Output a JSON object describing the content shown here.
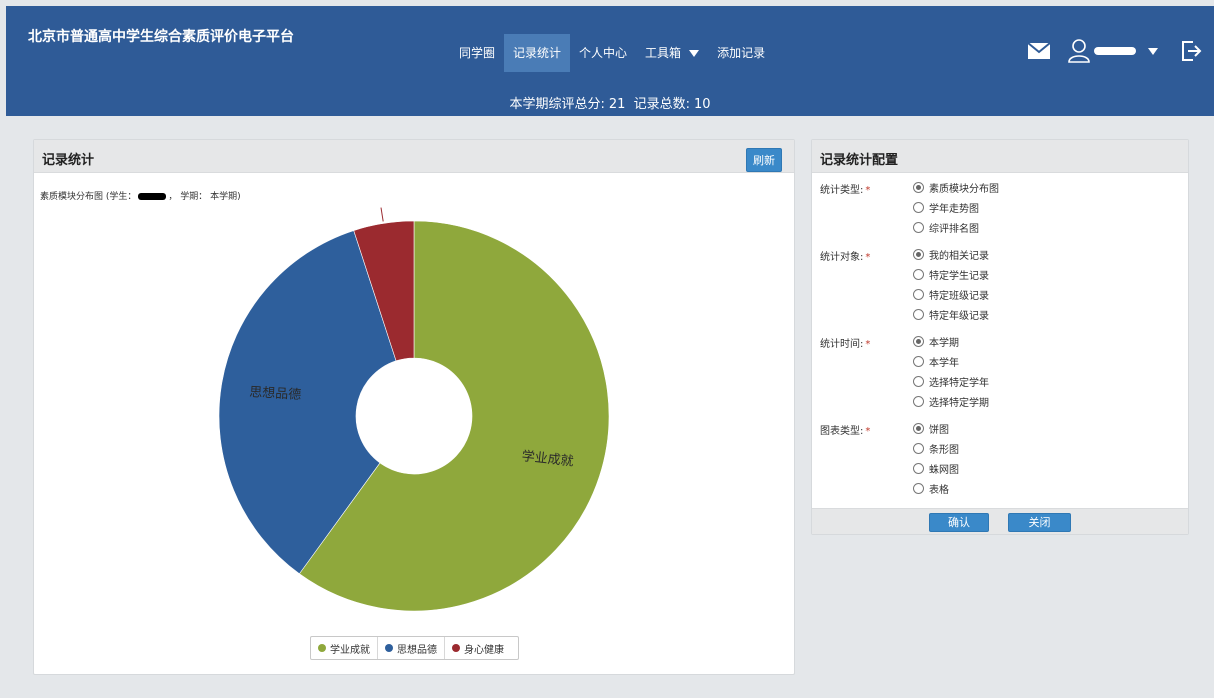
{
  "app_title": "北京市普通高中学生综合素质评价电子平台",
  "nav": [
    {
      "label": "同学圈",
      "active": false
    },
    {
      "label": "记录统计",
      "active": true
    },
    {
      "label": "个人中心",
      "active": false
    },
    {
      "label": "工具箱",
      "active": false,
      "dropdown": true
    },
    {
      "label": "添加记录",
      "active": false
    }
  ],
  "summary": {
    "score_label": "本学期综评总分:",
    "score": "21",
    "count_label": "记录总数:",
    "count": "10"
  },
  "header_icons": [
    "mail-icon",
    "user-icon",
    "chevron-down-icon",
    "logout-icon"
  ],
  "left_panel": {
    "title": "记录统计",
    "refresh_label": "刷新",
    "caption_prefix": "素质模块分布图 (学生：",
    "caption_suffix": "，  学期： 本学期)"
  },
  "chart_data": {
    "type": "pie",
    "donut": true,
    "categories": [
      "学业成就",
      "思想品德",
      "身心健康"
    ],
    "values": [
      6,
      3.5,
      0.5
    ],
    "colors": [
      "#8fa83c",
      "#2e5f9c",
      "#9b2a2f"
    ],
    "slice_labels": [
      "学业成就",
      "思想品德",
      ""
    ],
    "legend": [
      "学业成就",
      "思想品德",
      "身心健康"
    ],
    "legend_placement": "bottom"
  },
  "right_panel": {
    "title": "记录统计配置",
    "groups": [
      {
        "label": "统计类型:",
        "options": [
          "素质模块分布图",
          "学年走势图",
          "综评排名图"
        ],
        "selected": 0
      },
      {
        "label": "统计对象:",
        "options": [
          "我的相关记录",
          "特定学生记录",
          "特定班级记录",
          "特定年级记录"
        ],
        "selected": 0
      },
      {
        "label": "统计时间:",
        "options": [
          "本学期",
          "本学年",
          "选择特定学年",
          "选择特定学期"
        ],
        "selected": 0
      },
      {
        "label": "图表类型:",
        "options": [
          "饼图",
          "条形图",
          "蛛网图",
          "表格"
        ],
        "selected": 0
      }
    ],
    "required_mark": "*",
    "confirm_label": "确认",
    "close_label": "关闭"
  }
}
